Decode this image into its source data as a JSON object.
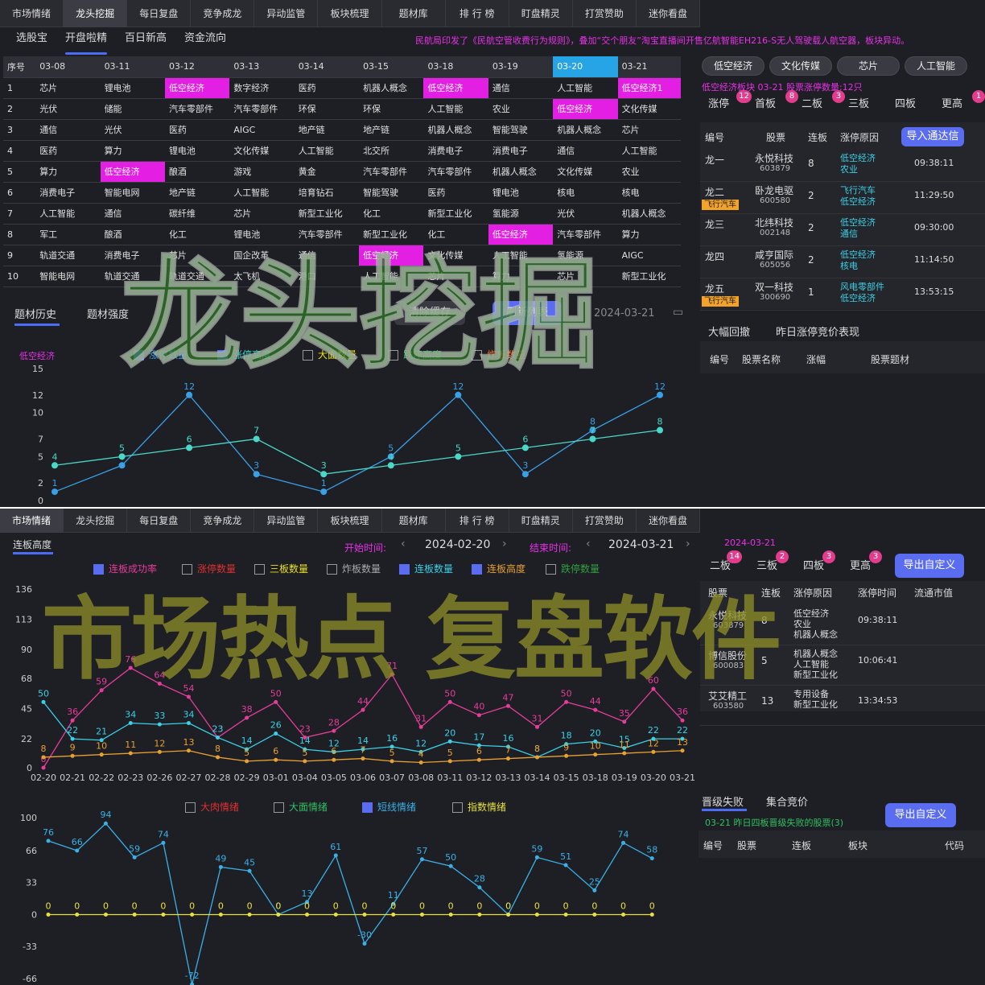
{
  "top_tabs": [
    "市场情绪",
    "龙头挖掘",
    "每日复盘",
    "竞争成龙",
    "异动监管",
    "板块梳理",
    "题材库",
    "排 行 榜",
    "盯盘精灵",
    "打赏赞助",
    "迷你看盘"
  ],
  "sub_tabs": [
    "选股宝",
    "开盘啦精",
    "百日新高",
    "资金流向"
  ],
  "marquee": "民航局印发了《民航空管收费行为规则》，叠加“交个朋友”淘宝直播间开售亿航智能EH216-S无人驾驶载人航空器，板块异动。",
  "grid": {
    "headers": [
      "序号",
      "03-08",
      "03-11",
      "03-12",
      "03-13",
      "03-14",
      "03-15",
      "03-18",
      "03-19",
      "03-20",
      "03-21"
    ],
    "rows": [
      [
        "1",
        "芯片",
        "锂电池",
        "低空经济",
        "数字经济",
        "医药",
        "机器人概念",
        "低空经济",
        "通信",
        "人工智能",
        "低空经济1"
      ],
      [
        "2",
        "光伏",
        "储能",
        "汽车零部件",
        "汽车零部件",
        "环保",
        "环保",
        "人工智能",
        "农业",
        "低空经济",
        "文化传媒"
      ],
      [
        "3",
        "通信",
        "光伏",
        "医药",
        "AIGC",
        "地产链",
        "地产链",
        "机器人概念",
        "智能驾驶",
        "机器人概念",
        "芯片"
      ],
      [
        "4",
        "医药",
        "算力",
        "锂电池",
        "文化传媒",
        "人工智能",
        "北交所",
        "消费电子",
        "消费电子",
        "通信",
        "人工智能"
      ],
      [
        "5",
        "算力",
        "低空经济",
        "酿酒",
        "游戏",
        "黄金",
        "汽车零部件",
        "汽车零部件",
        "机器人概念",
        "文化传媒",
        "农业"
      ],
      [
        "6",
        "消费电子",
        "智能电网",
        "地产链",
        "人工智能",
        "培育钻石",
        "智能驾驶",
        "医药",
        "锂电池",
        "核电",
        "核电"
      ],
      [
        "7",
        "人工智能",
        "通信",
        "碳纤维",
        "芯片",
        "新型工业化",
        "化工",
        "新型工业化",
        "氢能源",
        "光伏",
        "机器人概念"
      ],
      [
        "8",
        "军工",
        "酿酒",
        "化工",
        "锂电池",
        "汽车零部件",
        "新型工业化",
        "化工",
        "低空经济",
        "汽车零部件",
        "算力"
      ],
      [
        "9",
        "轨道交通",
        "消费电子",
        "芯片",
        "国企改革",
        "通信",
        "低空经济",
        "文化传媒",
        "人工智能",
        "氢能源",
        "AIGC"
      ],
      [
        "10",
        "智能电网",
        "轨道交通",
        "轨道交通",
        "太飞机",
        "港口",
        "人工智能",
        "芯片",
        "算力",
        "芯片",
        "新型工业化"
      ]
    ]
  },
  "chips": [
    "低空经济",
    "文化传媒",
    "芯片",
    "人工智能"
  ],
  "sector_info": "低空经济板块 03-21  股票涨停数量:12只",
  "rtabs": [
    {
      "label": "涨停",
      "badge": "12"
    },
    {
      "label": "首板",
      "badge": "8"
    },
    {
      "label": "二板",
      "badge": "3"
    },
    {
      "label": "三板",
      "badge": ""
    },
    {
      "label": "四板",
      "badge": ""
    },
    {
      "label": "更高",
      "badge": "1"
    }
  ],
  "stock_table": {
    "headers": [
      "编号",
      "股票",
      "连板",
      "涨停原因"
    ],
    "export": "导入通达信",
    "rows": [
      {
        "id": "龙一",
        "tag": "",
        "name": "永悦科技",
        "code": "603879",
        "lb": "8",
        "reason1": "低空经济",
        "reason2": "农业",
        "time": "09:38:11"
      },
      {
        "id": "龙二",
        "tag": "飞行汽车",
        "name": "卧龙电驱",
        "code": "600580",
        "lb": "2",
        "reason1": "飞行汽车",
        "reason2": "低空经济",
        "time": "11:29:50"
      },
      {
        "id": "龙三",
        "tag": "",
        "name": "北纬科技",
        "code": "002148",
        "lb": "2",
        "reason1": "低空经济",
        "reason2": "通信",
        "time": "09:30:00"
      },
      {
        "id": "龙四",
        "tag": "",
        "name": "咸亨国际",
        "code": "605056",
        "lb": "2",
        "reason1": "低空经济",
        "reason2": "核电",
        "time": "11:14:50"
      },
      {
        "id": "龙五",
        "tag": "飞行汽车",
        "name": "双一科技",
        "code": "300690",
        "lb": "1",
        "reason1": "风电零部件",
        "reason2": "低空经济",
        "time": "13:53:15"
      }
    ]
  },
  "lower_right_tabs": [
    "大幅回撤",
    "昨日涨停竞价表现"
  ],
  "lower_right_headers": [
    "编号",
    "股票名称",
    "涨幅",
    "股票题材"
  ],
  "history_tabs": [
    "题材历史",
    "题材强度"
  ],
  "history_buttons": {
    "clear": "清除缓存",
    "refresh": "刷新列表",
    "date": "2024-03-21"
  },
  "hist_checks": [
    {
      "label": "涨停数量",
      "on": true,
      "color": "#3aa0e6"
    },
    {
      "label": "涨停高度",
      "on": true,
      "color": "#3ad0c0"
    },
    {
      "label": "大面数量",
      "on": false,
      "color": "#e8e020"
    },
    {
      "label": "跌停高度",
      "on": false,
      "color": "#30c060"
    },
    {
      "label": "炸板数量",
      "on": false,
      "color": "#f07020"
    }
  ],
  "hist_chart_label": "低空经济",
  "watermark1": "龙头挖掘",
  "watermark2": "市场热点 复盘软件",
  "chart_data": [
    {
      "type": "line",
      "title": "低空经济",
      "x": [
        "03-08",
        "03-11",
        "03-12",
        "03-13",
        "03-14",
        "03-15",
        "03-18",
        "03-19",
        "03-20",
        "03-21"
      ],
      "ylim": [
        0,
        15
      ],
      "yticks": [
        0,
        2,
        5,
        7,
        10,
        12,
        15
      ],
      "series": [
        {
          "name": "涨停数量",
          "color": "#3aa0e6",
          "values": [
            1,
            4,
            12,
            3,
            1,
            5,
            12,
            3,
            8,
            12
          ]
        },
        {
          "name": "涨停高度",
          "color": "#4ad8c8",
          "values": [
            4,
            5,
            6,
            7,
            3,
            4,
            5,
            6,
            7,
            8
          ]
        }
      ]
    },
    {
      "type": "line",
      "title": "连板高度",
      "x": [
        "02-20",
        "02-21",
        "02-22",
        "02-23",
        "02-26",
        "02-27",
        "02-28",
        "02-29",
        "03-01",
        "03-04",
        "03-05",
        "03-06",
        "03-07",
        "03-08",
        "03-11",
        "03-12",
        "03-13",
        "03-14",
        "03-15",
        "03-18",
        "03-19",
        "03-20",
        "03-21"
      ],
      "ylim": [
        0,
        136
      ],
      "yticks": [
        0,
        22,
        45,
        68,
        90,
        113,
        136
      ],
      "series": [
        {
          "name": "连板成功率",
          "color": "#e63c9a",
          "values": [
            0,
            36,
            59,
            76,
            64,
            54,
            23,
            38,
            50,
            23,
            28,
            44,
            71,
            31,
            50,
            40,
            47,
            31,
            50,
            44,
            35,
            60,
            36
          ]
        },
        {
          "name": "连板数量",
          "color": "#3ad0e6",
          "values": [
            50,
            22,
            21,
            34,
            33,
            34,
            23,
            14,
            26,
            14,
            12,
            14,
            16,
            12,
            20,
            17,
            16,
            8,
            18,
            20,
            15,
            22,
            22
          ]
        },
        {
          "name": "连板高度",
          "color": "#e8a030",
          "values": [
            8,
            9,
            10,
            11,
            12,
            13,
            8,
            5,
            6,
            5,
            6,
            7,
            5,
            4,
            5,
            6,
            7,
            8,
            9,
            10,
            11,
            12,
            13
          ]
        }
      ]
    },
    {
      "type": "line",
      "x": [
        "02-20",
        "02-21",
        "02-22",
        "02-23",
        "02-26",
        "02-27",
        "02-28",
        "02-29",
        "03-01",
        "03-04",
        "03-05",
        "03-06",
        "03-07",
        "03-08",
        "03-11",
        "03-12",
        "03-13",
        "03-14",
        "03-15",
        "03-18",
        "03-19",
        "03-20",
        "03-21"
      ],
      "ylim": [
        -66,
        100
      ],
      "yticks": [
        -66,
        -33,
        0,
        33,
        66,
        100
      ],
      "series": [
        {
          "name": "短线情绪",
          "color": "#3ab0e6",
          "values": [
            76,
            66,
            94,
            59,
            74,
            -72,
            49,
            45,
            0,
            13,
            61,
            -30,
            11,
            57,
            50,
            28,
            0,
            59,
            51,
            25,
            74,
            58
          ]
        },
        {
          "name": "指数情绪",
          "color": "#e8e040",
          "values": [
            0,
            0,
            0,
            0,
            0,
            0,
            0,
            0,
            0,
            0,
            0,
            0,
            0,
            0,
            0,
            0,
            0,
            0,
            0,
            0,
            0,
            0
          ]
        }
      ]
    }
  ],
  "bottom": {
    "tabs": [
      "市场情绪",
      "龙头挖掘",
      "每日复盘",
      "竞争成龙",
      "异动监管",
      "板块梳理",
      "题材库",
      "排 行 榜",
      "盯盘精灵",
      "打赏赞助",
      "迷你看盘"
    ],
    "chart_title": "连板高度",
    "start_label": "开始时间:",
    "start": "2024-02-20",
    "end_label": "结束时间:",
    "end": "2024-03-21",
    "checks1": [
      {
        "label": "连板成功率",
        "on": true,
        "color": "#e63c9a"
      },
      {
        "label": "涨停数量",
        "on": false,
        "color": "#e03030"
      },
      {
        "label": "三板数量",
        "on": false,
        "color": "#e8e020"
      },
      {
        "label": "炸板数量",
        "on": false,
        "color": "#aaa"
      },
      {
        "label": "连板数量",
        "on": true,
        "color": "#3ad0e6"
      },
      {
        "label": "连板高度",
        "on": true,
        "color": "#e8a030"
      },
      {
        "label": "跌停数量",
        "on": false,
        "color": "#30a040"
      }
    ],
    "checks2": [
      {
        "label": "大肉情绪",
        "on": false,
        "color": "#e03030"
      },
      {
        "label": "大面情绪",
        "on": false,
        "color": "#30c060"
      },
      {
        "label": "短线情绪",
        "on": true,
        "color": "#3ab0e6"
      },
      {
        "label": "指数情绪",
        "on": false,
        "color": "#e8e040"
      }
    ],
    "date": "2024-03-21",
    "rtabs": [
      {
        "label": "二板",
        "badge": "14"
      },
      {
        "label": "三板",
        "badge": "2"
      },
      {
        "label": "四板",
        "badge": "3"
      },
      {
        "label": "更高",
        "badge": "3"
      }
    ],
    "export": "导出自定义",
    "rheaders": [
      "股票",
      "连板",
      "涨停原因",
      "涨停时间",
      "流通市值"
    ],
    "rrows": [
      {
        "name": "永悦科技",
        "code": "603879",
        "lb": "8",
        "reason": [
          "低空经济",
          "农业",
          "机器人概念"
        ],
        "time": "09:38:11"
      },
      {
        "name": "博信股份",
        "code": "600083",
        "lb": "5",
        "reason": [
          "机器人概念",
          "人工智能",
          "新型工业化"
        ],
        "time": "10:06:41"
      },
      {
        "name": "艾艾精工",
        "code": "603580",
        "lb": "13",
        "reason": [
          "专用设备",
          "新型工业化"
        ],
        "time": "13:34:53"
      }
    ],
    "fail_tabs": [
      "晋级失败",
      "集合竞价"
    ],
    "fail_info": "03-21  昨日四板晋级失败的股票(3)",
    "fail_export": "导出自定义",
    "fail_headers": [
      "编号",
      "股票",
      "连板",
      "板块",
      "代码"
    ]
  }
}
